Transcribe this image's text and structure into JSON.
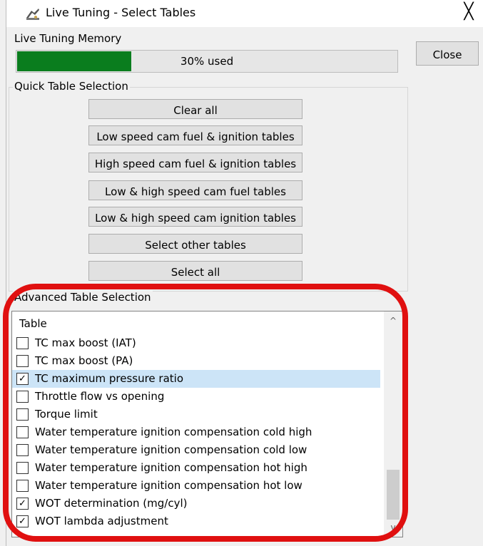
{
  "window": {
    "title": "Live Tuning - Select Tables",
    "close_glyph": "╳"
  },
  "memory": {
    "legend": "Live Tuning Memory",
    "used_fraction": 0.3,
    "text": "30% used",
    "bar_color": "#0a7d1e"
  },
  "buttons": {
    "close": "Close"
  },
  "quick": {
    "legend": "Quick Table Selection",
    "buttons": [
      "Clear all",
      "Low speed cam fuel & ignition tables",
      "High speed cam fuel & ignition tables",
      "Low & high speed cam fuel tables",
      "Low & high speed cam ignition tables",
      "Select other tables",
      "Select all"
    ]
  },
  "advanced": {
    "legend": "Advanced Table Selection",
    "column_header": "Table",
    "rows": [
      {
        "label": "TC max boost (IAT)",
        "checked": false,
        "selected": false
      },
      {
        "label": "TC max boost (PA)",
        "checked": false,
        "selected": false
      },
      {
        "label": "TC maximum pressure ratio",
        "checked": true,
        "selected": true
      },
      {
        "label": "Throttle flow vs opening",
        "checked": false,
        "selected": false
      },
      {
        "label": "Torque limit",
        "checked": false,
        "selected": false
      },
      {
        "label": "Water temperature ignition compensation cold high",
        "checked": false,
        "selected": false
      },
      {
        "label": "Water temperature ignition compensation cold low",
        "checked": false,
        "selected": false
      },
      {
        "label": "Water temperature ignition compensation hot high",
        "checked": false,
        "selected": false
      },
      {
        "label": "Water temperature ignition compensation hot low",
        "checked": false,
        "selected": false
      },
      {
        "label": "WOT determination (mg/cyl)",
        "checked": true,
        "selected": false
      },
      {
        "label": "WOT lambda adjustment",
        "checked": true,
        "selected": false
      }
    ],
    "check_glyph": "✓",
    "scroll_up_glyph": "^",
    "scroll_down_glyph": "v"
  },
  "annotation_color": "#e01010"
}
